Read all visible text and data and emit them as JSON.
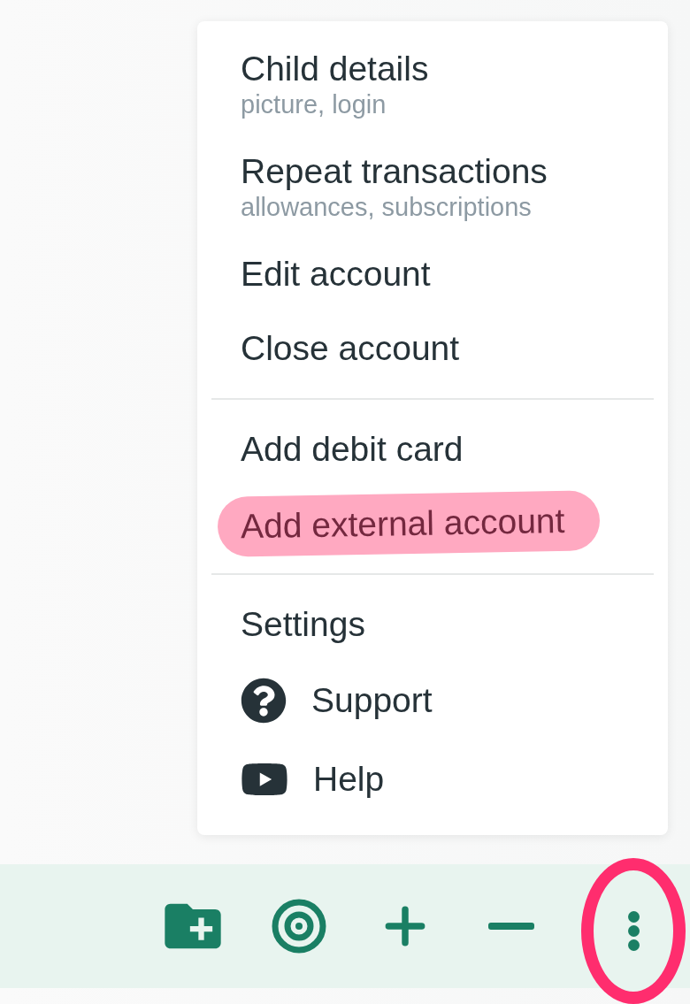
{
  "menu": {
    "groups": [
      {
        "items": [
          {
            "label": "Child details",
            "subtitle": "picture, login",
            "highlighted": false
          },
          {
            "label": "Repeat transactions",
            "subtitle": "allowances, subscriptions",
            "highlighted": false
          },
          {
            "label": "Edit account",
            "highlighted": false
          },
          {
            "label": "Close account",
            "highlighted": false
          }
        ]
      },
      {
        "items": [
          {
            "label": "Add debit card",
            "highlighted": false
          },
          {
            "label": "Add external account",
            "highlighted": true
          }
        ]
      },
      {
        "items": [
          {
            "label": "Settings",
            "highlighted": false
          },
          {
            "label": "Support",
            "kind": "help",
            "highlighted": false
          },
          {
            "label": "Help",
            "kind": "video",
            "highlighted": false
          }
        ]
      }
    ]
  },
  "toolbar": [
    {
      "kind": "new-folder",
      "circled": false
    },
    {
      "kind": "target",
      "circled": false
    },
    {
      "kind": "add",
      "circled": false
    },
    {
      "kind": "subtract",
      "circled": false
    },
    {
      "kind": "more",
      "circled": true
    }
  ]
}
